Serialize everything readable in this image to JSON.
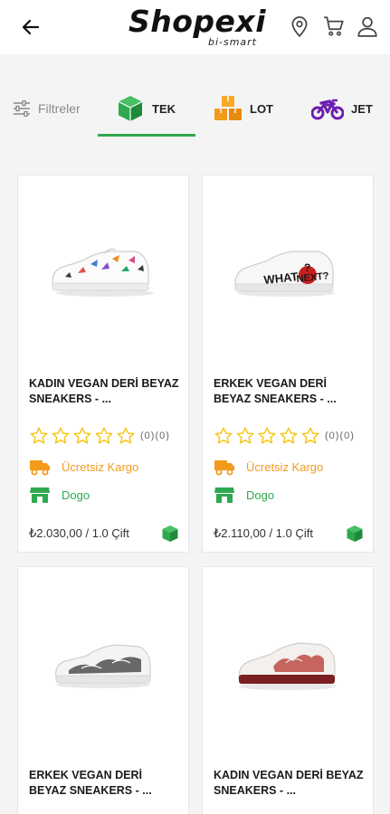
{
  "header": {
    "logo_main": "Shopexi",
    "logo_sub": "bi-smart"
  },
  "tabs": {
    "filters_label": "Filtreler",
    "items": [
      {
        "label": "TEK",
        "color": "#2fa84f",
        "icon": "cube-icon",
        "active": true
      },
      {
        "label": "LOT",
        "color": "#f39a1b",
        "icon": "boxes-icon",
        "active": false
      },
      {
        "label": "JET",
        "color": "#6c1fb0",
        "icon": "motorcycle-icon",
        "active": false
      }
    ]
  },
  "products": [
    {
      "title": "KADIN VEGAN DERİ BEYAZ SNEAKERS - ...",
      "rating": "(0)(0)",
      "shipping": "Ücretsiz Kargo",
      "store": "Dogo",
      "price": "₺2.030,00 / 1.0 Çift"
    },
    {
      "title": "ERKEK VEGAN DERİ BEYAZ SNEAKERS - ...",
      "rating": "(0)(0)",
      "shipping": "Ücretsiz Kargo",
      "store": "Dogo",
      "price": "₺2.110,00 / 1.0 Çift"
    },
    {
      "title": "ERKEK VEGAN DERİ BEYAZ SNEAKERS - ...",
      "rating": "",
      "shipping": "",
      "store": "",
      "price": ""
    },
    {
      "title": "KADIN VEGAN DERİ BEYAZ SNEAKERS - ...",
      "rating": "",
      "shipping": "",
      "store": "",
      "price": ""
    }
  ],
  "colors": {
    "accent_green": "#2fa84f",
    "accent_orange": "#f39a1b",
    "accent_purple": "#6c1fb0",
    "star_yellow": "#f5c518"
  }
}
